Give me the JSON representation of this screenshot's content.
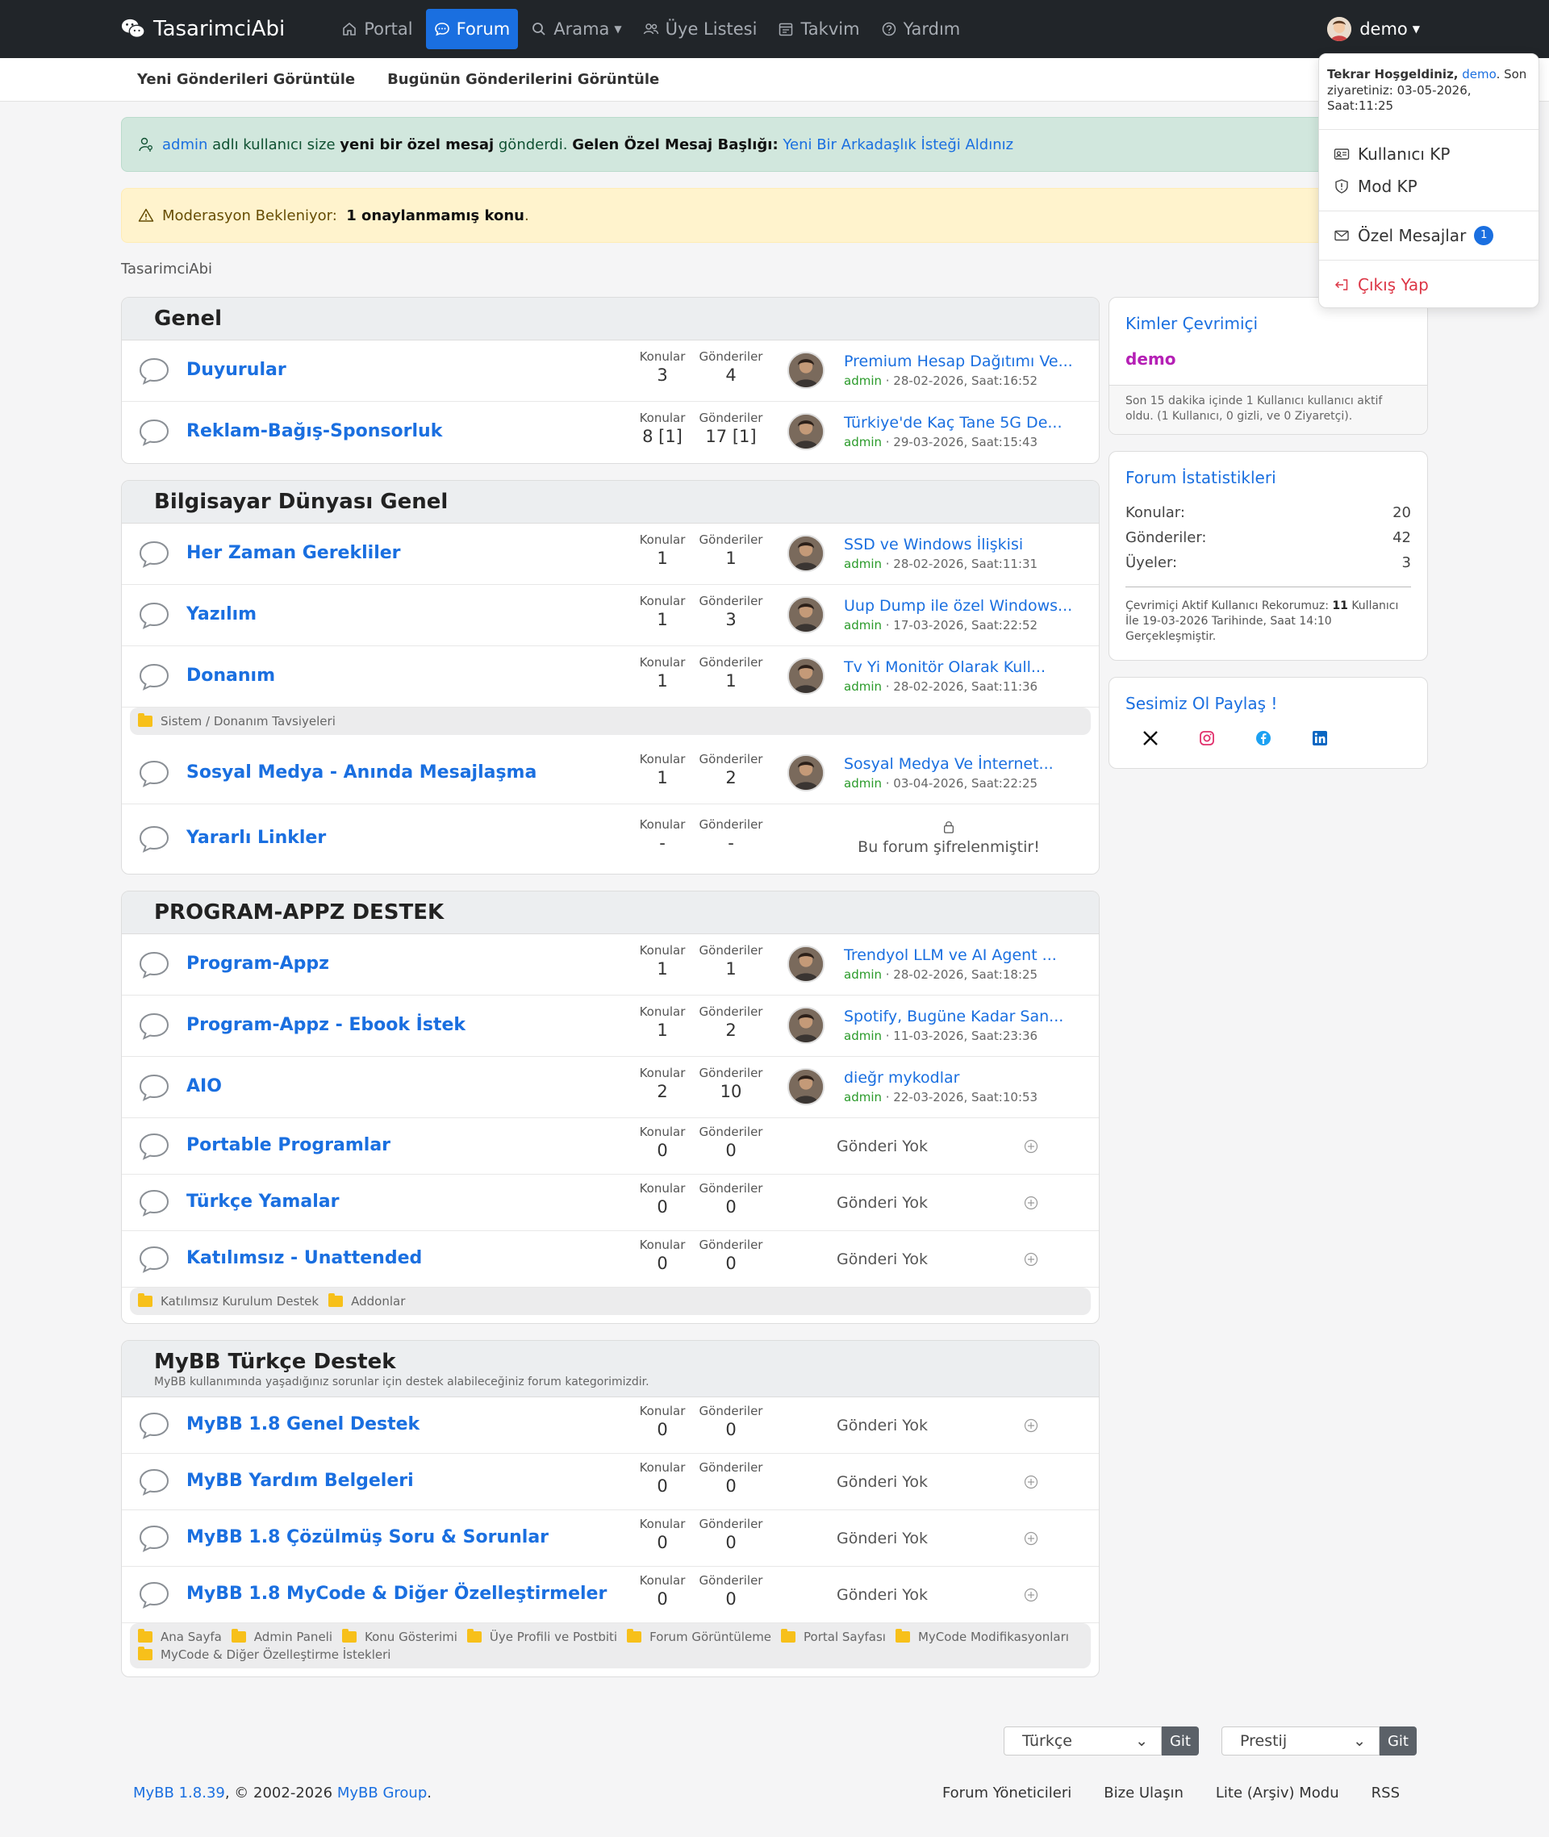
{
  "brand": {
    "name": "TasarimciAbi"
  },
  "nav": {
    "items": [
      {
        "label": "Portal",
        "icon": "home-icon"
      },
      {
        "label": "Forum",
        "icon": "chat-icon"
      },
      {
        "label": "Arama",
        "icon": "search-icon"
      },
      {
        "label": "Üye Listesi",
        "icon": "users-icon"
      },
      {
        "label": "Takvim",
        "icon": "calendar-icon"
      },
      {
        "label": "Yardım",
        "icon": "help-icon"
      }
    ],
    "user": "demo"
  },
  "subbar": {
    "new_posts": "Yeni Gönderileri Görüntüle",
    "today_posts": "Bugünün Gönderilerini Görüntüle"
  },
  "dropdown": {
    "welcome_prefix": "Tekrar Hoşgeldiniz,",
    "welcome_user": "demo",
    "welcome_suffix": ". Son ziyaretiniz: 03-05-2026, Saat:11:25",
    "user_cp": "Kullanıcı KP",
    "mod_cp": "Mod KP",
    "pm": "Özel Mesajlar",
    "pm_count": "1",
    "logout": "Çıkış Yap"
  },
  "alerts": {
    "pm_user": "admin",
    "pm_text1": " adlı kullanıcı size ",
    "pm_bold": "yeni bir özel mesaj",
    "pm_text2": " gönderdi. ",
    "pm_title_label": "Gelen Özel Mesaj Başlığı:",
    "pm_title": "Yeni Bir Arkadaşlık İsteği Aldınız",
    "mod_label": "Moderasyon Bekleniyor:",
    "mod_value": "1 onaylanmamış konu",
    "mod_dot": "."
  },
  "breadcrumb": "TasarimciAbi",
  "labels": {
    "topics": "Konular",
    "posts": "Gönderiler",
    "no_posts": "Gönderi Yok",
    "locked": "Bu forum şifrelenmiştir!"
  },
  "categories": [
    {
      "title": "Genel",
      "forums": [
        {
          "name": "Duyurular",
          "topics": "3",
          "posts": "4",
          "last_title": "Premium Hesap Dağıtımı Ve...",
          "last_user": "admin",
          "last_date": " · 28-02-2026, Saat:16:52"
        },
        {
          "name": "Reklam-Bağış-Sponsorluk",
          "topics": "8 [1]",
          "posts": "17 [1]",
          "last_title": "Türkiye'de Kaç Tane 5G De...",
          "last_user": "admin",
          "last_date": " · 29-03-2026, Saat:15:43"
        }
      ]
    },
    {
      "title": "Bilgisayar Dünyası Genel",
      "forums": [
        {
          "name": "Her Zaman Gerekliler",
          "topics": "1",
          "posts": "1",
          "last_title": "SSD ve Windows İlişkisi",
          "last_user": "admin",
          "last_date": " · 28-02-2026, Saat:11:31"
        },
        {
          "name": "Yazılım",
          "topics": "1",
          "posts": "3",
          "last_title": "Uup Dump ile özel Windows...",
          "last_user": "admin",
          "last_date": " · 17-03-2026, Saat:22:52"
        },
        {
          "name": "Donanım",
          "topics": "1",
          "posts": "1",
          "last_title": "Tv Yi Monitör Olarak Kull...",
          "last_user": "admin",
          "last_date": " · 28-02-2026, Saat:11:36"
        },
        {
          "name": "Sosyal Medya - Anında Mesajlaşma",
          "topics": "1",
          "posts": "2",
          "last_title": "Sosyal Medya Ve İnternet...",
          "last_user": "admin",
          "last_date": " · 03-04-2026, Saat:22:25"
        },
        {
          "name": "Yararlı Linkler",
          "topics": "-",
          "posts": "-"
        }
      ],
      "subforums_donanim": [
        "Sistem / Donanım Tavsiyeleri"
      ]
    },
    {
      "title": "PROGRAM-APPZ DESTEK",
      "forums": [
        {
          "name": "Program-Appz",
          "topics": "1",
          "posts": "1",
          "last_title": "Trendyol LLM ve AI Agent ...",
          "last_user": "admin",
          "last_date": " · 28-02-2026, Saat:18:25"
        },
        {
          "name": "Program-Appz - Ebook İstek",
          "topics": "1",
          "posts": "2",
          "last_title": "Spotify, Bugüne Kadar San...",
          "last_user": "admin",
          "last_date": " · 11-03-2026, Saat:23:36"
        },
        {
          "name": "AIO",
          "topics": "2",
          "posts": "10",
          "last_title": "dieğr mykodlar",
          "last_user": "admin",
          "last_date": " · 22-03-2026, Saat:10:53"
        },
        {
          "name": "Portable Programlar",
          "topics": "0",
          "posts": "0"
        },
        {
          "name": "Türkçe Yamalar",
          "topics": "0",
          "posts": "0"
        },
        {
          "name": "Katılımsız - Unattended",
          "topics": "0",
          "posts": "0"
        }
      ],
      "subforums": [
        "Katılımsız Kurulum Destek",
        "Addonlar"
      ]
    },
    {
      "title": "MyBB Türkçe Destek",
      "description": "MyBB kullanımında yaşadığınız sorunlar için destek alabileceğiniz forum kategorimizdir.",
      "forums": [
        {
          "name": "MyBB 1.8 Genel Destek",
          "topics": "0",
          "posts": "0"
        },
        {
          "name": "MyBB Yardım Belgeleri",
          "topics": "0",
          "posts": "0"
        },
        {
          "name": "MyBB 1.8 Çözülmüş Soru & Sorunlar",
          "topics": "0",
          "posts": "0"
        },
        {
          "name": "MyBB 1.8 MyCode & Diğer Özelleştirmeler",
          "topics": "0",
          "posts": "0"
        }
      ],
      "subforums": [
        "Ana Sayfa",
        "Admin Paneli",
        "Konu Gösterimi",
        "Üye Profili ve Postbiti",
        "Forum Görüntüleme",
        "Portal Sayfası",
        "MyCode Modifikasyonları",
        "MyCode & Diğer Özelleştirme İstekleri"
      ]
    }
  ],
  "sidebar": {
    "online_title": "Kimler Çevrimiçi",
    "online_user": "demo",
    "online_foot": "Son 15 dakika içinde 1 Kullanıcı kullanıcı aktif oldu. (1 Kullanıcı, 0 gizli, ve 0 Ziyaretçi).",
    "stats_title": "Forum İstatistikleri",
    "stats": [
      {
        "label": "Konular:",
        "value": "20"
      },
      {
        "label": "Gönderiler:",
        "value": "42"
      },
      {
        "label": "Üyeler:",
        "value": "3"
      }
    ],
    "record_prefix": "Çevrimiçi Aktif Kullanıcı Rekorumuz: ",
    "record_count": "11",
    "record_suffix": " Kullanıcı İle 19-03-2026 Tarihinde, Saat 14:10 Gerçekleşmiştir.",
    "social_title": "Sesimiz Ol Paylaş !"
  },
  "footer": {
    "language": "Türkçe",
    "theme": "Prestij",
    "go": "Git",
    "mybb_version": "MyBB 1.8.39",
    "copyright": ", © 2002-2026 ",
    "mybb_group": "MyBB Group",
    "dot": ".",
    "links": [
      "Forum Yöneticileri",
      "Bize Ulaşın",
      "Lite (Arşiv) Modu",
      "RSS"
    ]
  },
  "colors": {
    "accent": "#1a6fe0",
    "topbar": "#212529",
    "online_user": "#b520b5"
  }
}
